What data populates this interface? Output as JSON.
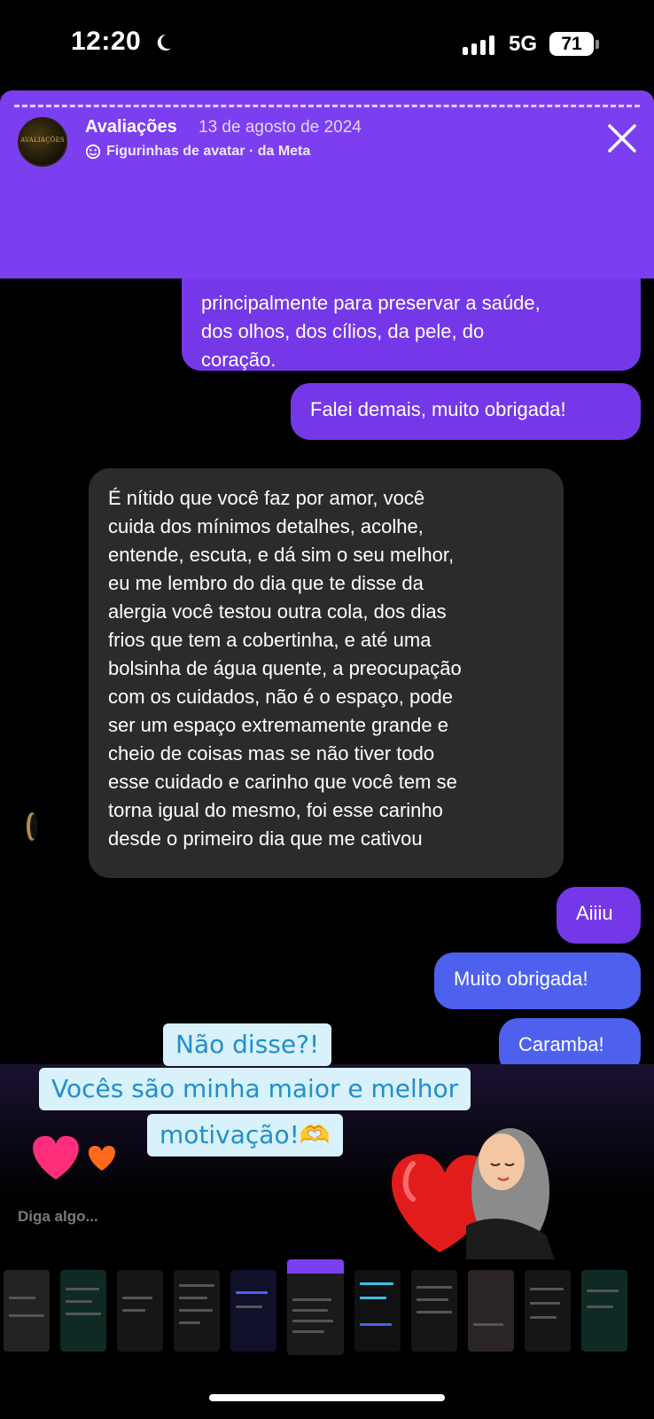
{
  "status_bar": {
    "time": "12:20",
    "network": "5G",
    "battery": "71"
  },
  "story": {
    "account_name": "Avaliações",
    "avatar_text": "AVALIAÇÕES",
    "date": "13 de agosto de 2024",
    "sticker_credit": "Figurinhas de avatar · da Meta"
  },
  "messages": [
    {
      "side": "sent",
      "text": "principalmente para preservar a saúde,\ndos olhos, dos cílios, da pele, do\ncoração."
    },
    {
      "side": "sent",
      "text": "Falei demais, muito obrigada!"
    },
    {
      "side": "received",
      "text": "É nítido que você faz por amor, você\ncuida dos mínimos detalhes, acolhe,\nentende, escuta, e dá sim o seu melhor,\neu me lembro do dia que te disse da\nalergia você testou outra cola, dos dias\nfrios que tem a cobertinha, e até uma\nbolsinha de água quente, a preocupação\ncom os cuidados, não é o espaço, pode\nser um espaço extremamente grande e\ncheio de coisas mas se não tiver todo\nesse cuidado e carinho que você tem se\ntorna igual do mesmo, foi esse carinho\ndesde o primeiro dia que me cativou"
    },
    {
      "side": "sent",
      "text": "Aiiiu"
    },
    {
      "side": "sent",
      "text": "Muito obrigada!"
    },
    {
      "side": "sent",
      "text": "Caramba!"
    }
  ],
  "caption": {
    "line1": "Não disse?!",
    "line2": "Vocês são minha maior e melhor",
    "line3": "motivação!🫶"
  },
  "reply_placeholder": "Diga algo...",
  "colors": {
    "header_purple": "#7b3ff0",
    "sent_bubble": "#7538e8",
    "sent_blue": "#4d61ee",
    "received_bubble": "#2b2b2d",
    "caption_bg": "#d8f1fa",
    "caption_text": "#1f8fcc"
  },
  "icons": [
    "moon-icon",
    "signal-icon",
    "battery-icon",
    "close-icon",
    "sticker-icon",
    "heart-icon"
  ]
}
